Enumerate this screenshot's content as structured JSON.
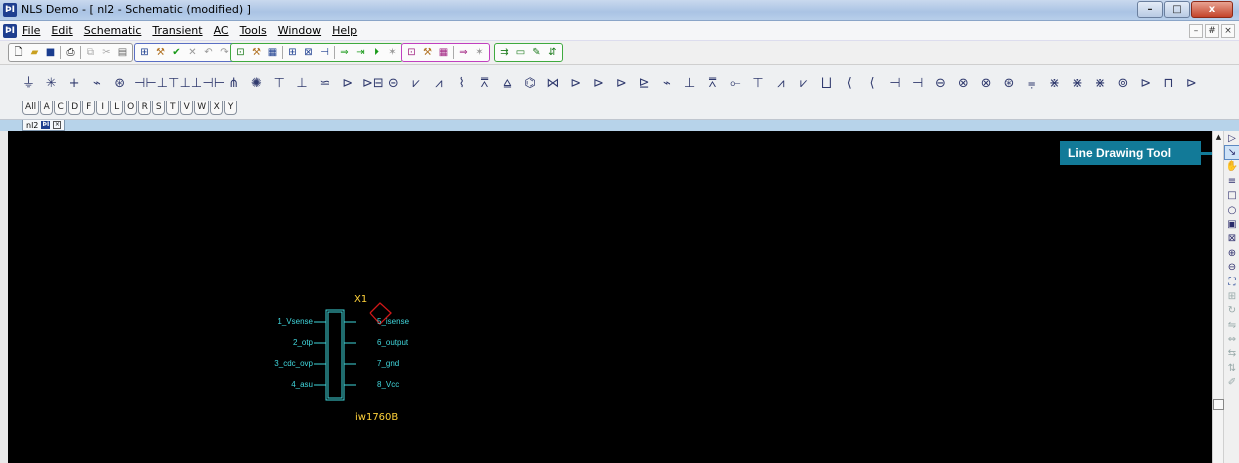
{
  "window": {
    "title": "NLS Demo - [ nl2 - Schematic (modified) ]",
    "app_icon": "nls-app-icon",
    "buttons": [
      "–",
      "□",
      "x"
    ]
  },
  "menubar": {
    "items": [
      "File",
      "Edit",
      "Schematic",
      "Transient",
      "AC",
      "Tools",
      "Window",
      "Help"
    ],
    "mdi_buttons": [
      "–",
      "#",
      "×"
    ]
  },
  "palette": {
    "tabs": [
      "All",
      "A",
      "C",
      "D",
      "F",
      "I",
      "L",
      "O",
      "R",
      "S",
      "T",
      "V",
      "W",
      "X",
      "Y"
    ]
  },
  "document_tab": {
    "label": "nl2"
  },
  "callout": {
    "label": "Line Drawing Tool",
    "color": "#127a98"
  },
  "component": {
    "ref": "X1",
    "name": "iw1760B",
    "pins_left": [
      "1_Vsense",
      "2_otp",
      "3_cdc_ovp",
      "4_asu"
    ],
    "pins_right": [
      "5_isense",
      "6_output",
      "7_gnd",
      "8_Vcc"
    ],
    "body_color": "#41d7dd",
    "label_color": "#ffd23a",
    "marker_color": "#d01818"
  },
  "colors": {
    "canvas": "#000000",
    "titlebar": "#aac3e4",
    "doctab_strip": "#b7d3ea"
  }
}
